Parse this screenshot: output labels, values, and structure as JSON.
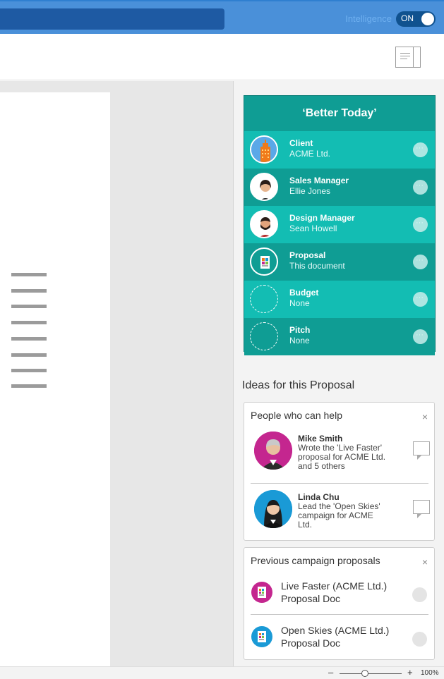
{
  "topbar": {
    "intelligence_label": "Intelligence",
    "toggle_state": "ON"
  },
  "team": {
    "title": "‘Better Today’",
    "rows": [
      {
        "role": "Client",
        "value": "ACME Ltd.",
        "avatar": "building-icon",
        "shade": "light"
      },
      {
        "role": "Sales Manager",
        "value": "Ellie Jones",
        "avatar": "woman-avatar",
        "shade": "dark"
      },
      {
        "role": "Design Manager",
        "value": "Sean Howell",
        "avatar": "bearded-man-avatar",
        "shade": "light"
      },
      {
        "role": "Proposal",
        "value": "This document",
        "avatar": "document-icon",
        "shade": "dark"
      },
      {
        "role": "Budget",
        "value": "None",
        "avatar": "empty-slot",
        "shade": "light"
      },
      {
        "role": "Pitch",
        "value": "None",
        "avatar": "empty-slot",
        "shade": "dark"
      }
    ]
  },
  "ideas": {
    "heading": "Ideas for this Proposal",
    "people_card": {
      "title": "People who can help",
      "close": "×",
      "people": [
        {
          "name": "Mike Smith",
          "desc": "Wrote the 'Live Faster' proposal for ACME Ltd. and 5 others",
          "avatar_color": "#c4268f"
        },
        {
          "name": "Linda Chu",
          "desc": "Lead the 'Open Skies' campaign for ACME Ltd.",
          "avatar_color": "#1a9ad6"
        }
      ]
    },
    "proposals_card": {
      "title": "Previous campaign proposals",
      "close": "×",
      "items": [
        {
          "title": "Live Faster (ACME Ltd.)",
          "subtitle": "Proposal Doc",
          "icon_color": "#c4268f"
        },
        {
          "title": "Open Skies (ACME Ltd.)",
          "subtitle": "Proposal Doc",
          "icon_color": "#1a9ad6"
        }
      ]
    }
  },
  "statusbar": {
    "zoom_minus": "–",
    "zoom_plus": "+",
    "zoom_level": "100%"
  }
}
